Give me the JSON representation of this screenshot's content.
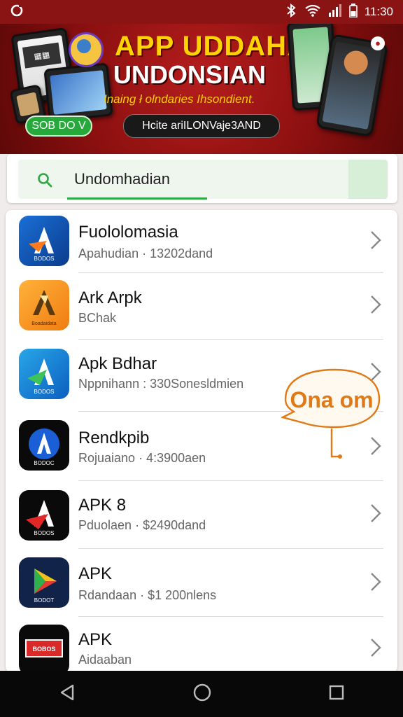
{
  "status": {
    "time": "11:30"
  },
  "banner": {
    "title_line1": "APP UDDAHAN",
    "title_line2": "UNDONSIAN",
    "subtitle": "Inaing ł olndaries Ihsondient.",
    "button_label": "SOB DO V",
    "pill_label": "Hcite ariILONVaje3AND"
  },
  "search": {
    "value": "Undomhadian"
  },
  "apps": [
    {
      "title": "Fuololomasia",
      "subtitle": "Apahudian · 13202dand",
      "icon_text": "BODOS"
    },
    {
      "title": "Ark Arpk",
      "subtitle": "BChak",
      "icon_text": "Boadaidata"
    },
    {
      "title": "Apk Bdhar",
      "subtitle": "Nppnihann : 330Sonesldmien",
      "icon_text": "BODOS"
    },
    {
      "title": "Rendkpib",
      "subtitle": "Rojuaiano · 4:3900aen",
      "icon_text": "BODOC"
    },
    {
      "title": "APK 8",
      "subtitle": "Pduolaen  ·  $2490dand",
      "icon_text": "BODOS"
    },
    {
      "title": "APK",
      "subtitle": "Rdandaan  ·  $1 200nlens",
      "icon_text": "BODOT"
    },
    {
      "title": "APK",
      "subtitle": "Aidaaban",
      "icon_text": "BOBOS"
    }
  ],
  "callout": {
    "text": "Ona om"
  }
}
